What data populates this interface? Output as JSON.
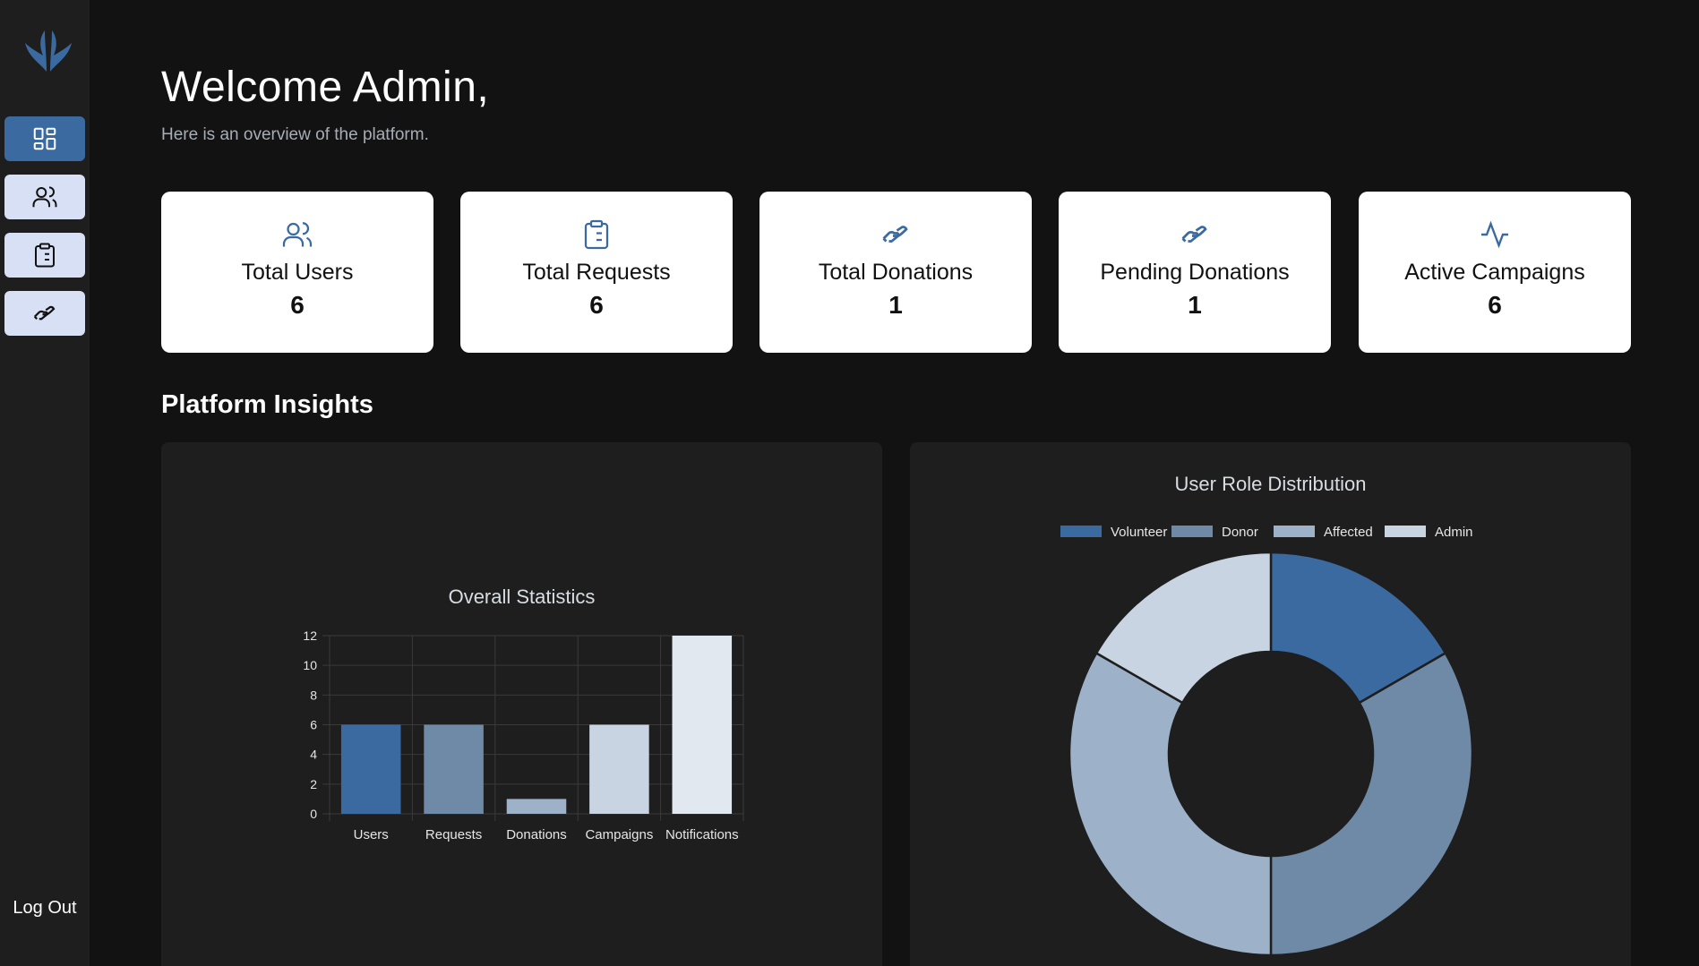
{
  "sidebar": {
    "logo_icon": "hands-logo-icon",
    "items": [
      {
        "icon": "dashboard-grid-icon",
        "active": true
      },
      {
        "icon": "users-icon",
        "active": false
      },
      {
        "icon": "clipboard-list-icon",
        "active": false
      },
      {
        "icon": "donation-hand-icon",
        "active": false
      }
    ],
    "logout_label": "Log Out"
  },
  "header": {
    "title": "Welcome Admin,",
    "subtitle": "Here is an overview of the platform."
  },
  "stats": [
    {
      "icon": "users-icon",
      "label": "Total Users",
      "value": "6"
    },
    {
      "icon": "clipboard-list-icon",
      "label": "Total Requests",
      "value": "6"
    },
    {
      "icon": "donation-hand-icon",
      "label": "Total Donations",
      "value": "1"
    },
    {
      "icon": "donation-hand-icon",
      "label": "Pending Donations",
      "value": "1"
    },
    {
      "icon": "activity-pulse-icon",
      "label": "Active Campaigns",
      "value": "6"
    }
  ],
  "insights": {
    "title": "Platform Insights"
  },
  "colors": {
    "accent": "#3b6aa0",
    "series": [
      "#3b6aa0",
      "#6f8aa6",
      "#9db1c9",
      "#c8d4e1",
      "#e1e8f0"
    ]
  },
  "chart_data": [
    {
      "type": "bar",
      "title": "Overall Statistics",
      "categories": [
        "Users",
        "Requests",
        "Donations",
        "Campaigns",
        "Notifications"
      ],
      "values": [
        6,
        6,
        1,
        6,
        12
      ],
      "ylim": [
        0,
        12
      ],
      "yticks": [
        0,
        2,
        4,
        6,
        8,
        10,
        12
      ],
      "grid": true,
      "legend": "none"
    },
    {
      "type": "pie",
      "variant": "doughnut",
      "title": "User Role Distribution",
      "labels": [
        "Volunteer",
        "Donor",
        "Affected",
        "Admin"
      ],
      "values": [
        1,
        2,
        2,
        1
      ],
      "legend": "top"
    }
  ]
}
